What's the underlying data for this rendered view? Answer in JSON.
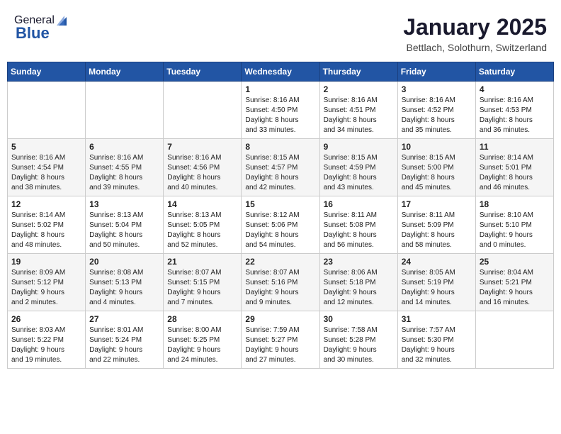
{
  "header": {
    "logo_general": "General",
    "logo_blue": "Blue",
    "main_title": "January 2025",
    "subtitle": "Bettlach, Solothurn, Switzerland"
  },
  "calendar": {
    "days_of_week": [
      "Sunday",
      "Monday",
      "Tuesday",
      "Wednesday",
      "Thursday",
      "Friday",
      "Saturday"
    ],
    "weeks": [
      [
        {
          "day": "",
          "info": ""
        },
        {
          "day": "",
          "info": ""
        },
        {
          "day": "",
          "info": ""
        },
        {
          "day": "1",
          "info": "Sunrise: 8:16 AM\nSunset: 4:50 PM\nDaylight: 8 hours\nand 33 minutes."
        },
        {
          "day": "2",
          "info": "Sunrise: 8:16 AM\nSunset: 4:51 PM\nDaylight: 8 hours\nand 34 minutes."
        },
        {
          "day": "3",
          "info": "Sunrise: 8:16 AM\nSunset: 4:52 PM\nDaylight: 8 hours\nand 35 minutes."
        },
        {
          "day": "4",
          "info": "Sunrise: 8:16 AM\nSunset: 4:53 PM\nDaylight: 8 hours\nand 36 minutes."
        }
      ],
      [
        {
          "day": "5",
          "info": "Sunrise: 8:16 AM\nSunset: 4:54 PM\nDaylight: 8 hours\nand 38 minutes."
        },
        {
          "day": "6",
          "info": "Sunrise: 8:16 AM\nSunset: 4:55 PM\nDaylight: 8 hours\nand 39 minutes."
        },
        {
          "day": "7",
          "info": "Sunrise: 8:16 AM\nSunset: 4:56 PM\nDaylight: 8 hours\nand 40 minutes."
        },
        {
          "day": "8",
          "info": "Sunrise: 8:15 AM\nSunset: 4:57 PM\nDaylight: 8 hours\nand 42 minutes."
        },
        {
          "day": "9",
          "info": "Sunrise: 8:15 AM\nSunset: 4:59 PM\nDaylight: 8 hours\nand 43 minutes."
        },
        {
          "day": "10",
          "info": "Sunrise: 8:15 AM\nSunset: 5:00 PM\nDaylight: 8 hours\nand 45 minutes."
        },
        {
          "day": "11",
          "info": "Sunrise: 8:14 AM\nSunset: 5:01 PM\nDaylight: 8 hours\nand 46 minutes."
        }
      ],
      [
        {
          "day": "12",
          "info": "Sunrise: 8:14 AM\nSunset: 5:02 PM\nDaylight: 8 hours\nand 48 minutes."
        },
        {
          "day": "13",
          "info": "Sunrise: 8:13 AM\nSunset: 5:04 PM\nDaylight: 8 hours\nand 50 minutes."
        },
        {
          "day": "14",
          "info": "Sunrise: 8:13 AM\nSunset: 5:05 PM\nDaylight: 8 hours\nand 52 minutes."
        },
        {
          "day": "15",
          "info": "Sunrise: 8:12 AM\nSunset: 5:06 PM\nDaylight: 8 hours\nand 54 minutes."
        },
        {
          "day": "16",
          "info": "Sunrise: 8:11 AM\nSunset: 5:08 PM\nDaylight: 8 hours\nand 56 minutes."
        },
        {
          "day": "17",
          "info": "Sunrise: 8:11 AM\nSunset: 5:09 PM\nDaylight: 8 hours\nand 58 minutes."
        },
        {
          "day": "18",
          "info": "Sunrise: 8:10 AM\nSunset: 5:10 PM\nDaylight: 9 hours\nand 0 minutes."
        }
      ],
      [
        {
          "day": "19",
          "info": "Sunrise: 8:09 AM\nSunset: 5:12 PM\nDaylight: 9 hours\nand 2 minutes."
        },
        {
          "day": "20",
          "info": "Sunrise: 8:08 AM\nSunset: 5:13 PM\nDaylight: 9 hours\nand 4 minutes."
        },
        {
          "day": "21",
          "info": "Sunrise: 8:07 AM\nSunset: 5:15 PM\nDaylight: 9 hours\nand 7 minutes."
        },
        {
          "day": "22",
          "info": "Sunrise: 8:07 AM\nSunset: 5:16 PM\nDaylight: 9 hours\nand 9 minutes."
        },
        {
          "day": "23",
          "info": "Sunrise: 8:06 AM\nSunset: 5:18 PM\nDaylight: 9 hours\nand 12 minutes."
        },
        {
          "day": "24",
          "info": "Sunrise: 8:05 AM\nSunset: 5:19 PM\nDaylight: 9 hours\nand 14 minutes."
        },
        {
          "day": "25",
          "info": "Sunrise: 8:04 AM\nSunset: 5:21 PM\nDaylight: 9 hours\nand 16 minutes."
        }
      ],
      [
        {
          "day": "26",
          "info": "Sunrise: 8:03 AM\nSunset: 5:22 PM\nDaylight: 9 hours\nand 19 minutes."
        },
        {
          "day": "27",
          "info": "Sunrise: 8:01 AM\nSunset: 5:24 PM\nDaylight: 9 hours\nand 22 minutes."
        },
        {
          "day": "28",
          "info": "Sunrise: 8:00 AM\nSunset: 5:25 PM\nDaylight: 9 hours\nand 24 minutes."
        },
        {
          "day": "29",
          "info": "Sunrise: 7:59 AM\nSunset: 5:27 PM\nDaylight: 9 hours\nand 27 minutes."
        },
        {
          "day": "30",
          "info": "Sunrise: 7:58 AM\nSunset: 5:28 PM\nDaylight: 9 hours\nand 30 minutes."
        },
        {
          "day": "31",
          "info": "Sunrise: 7:57 AM\nSunset: 5:30 PM\nDaylight: 9 hours\nand 32 minutes."
        },
        {
          "day": "",
          "info": ""
        }
      ]
    ]
  }
}
